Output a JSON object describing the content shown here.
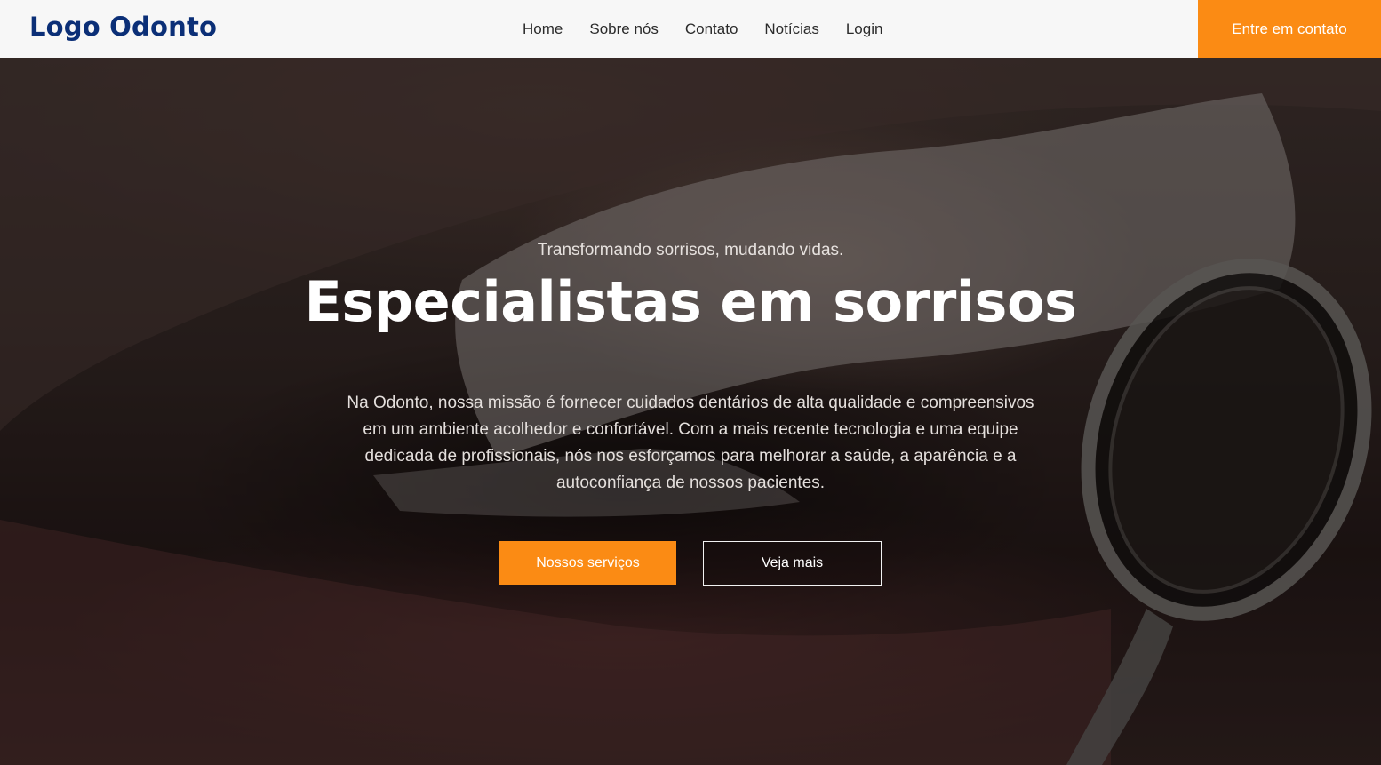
{
  "header": {
    "logo": "Logo Odonto",
    "nav": [
      "Home",
      "Sobre nós",
      "Contato",
      "Notícias",
      "Login"
    ],
    "cta": "Entre em contato"
  },
  "hero": {
    "background_image": "close-up-smile-with-dental-mirror",
    "tagline": "Transformando sorrisos, mudando vidas.",
    "headline": "Especialistas em sorrisos",
    "description": "Na Odonto, nossa missão é fornecer cuidados dentários de alta qualidade e compreensivos em um ambiente acolhedor e confortável. Com a mais recente tecnologia e uma equipe dedicada de profissionais, nós nos esforçamos para melhorar a saúde, a aparência e a autoconfiança de nossos pacientes.",
    "primary_button": "Nossos serviços",
    "secondary_button": "Veja mais"
  },
  "colors": {
    "brand_blue": "#0b2f77",
    "accent_orange": "#fb8b14",
    "header_bg": "#f7f7f7"
  }
}
